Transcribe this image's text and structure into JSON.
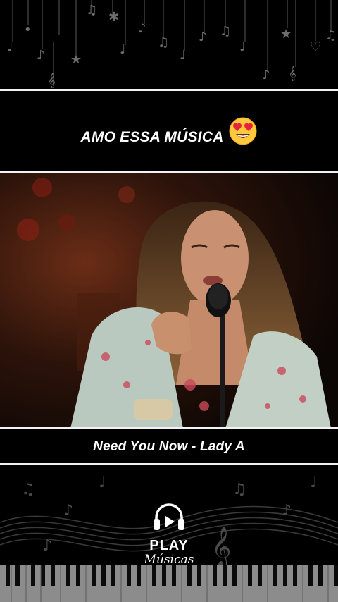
{
  "header_caption": "AMO ESSA MÚSICA",
  "header_emoji": "heart-eyes-emoji",
  "song_caption": "Need You Now - Lady A",
  "logo": {
    "line1": "PLAY",
    "line2": "Músicas"
  },
  "colors": {
    "background": "#000000",
    "divider": "#f2f2f2",
    "text": "#ffffff"
  }
}
